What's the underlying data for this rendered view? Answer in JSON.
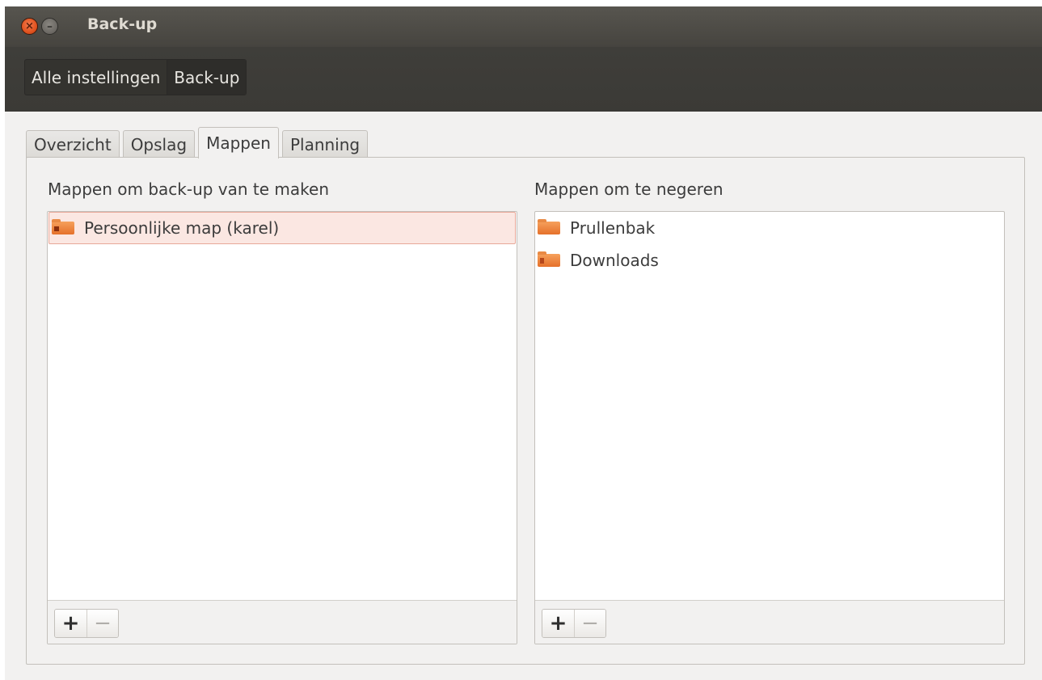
{
  "window": {
    "title": "Back-up",
    "close_glyph": "×",
    "minimize_glyph": "–"
  },
  "breadcrumb": {
    "items": [
      {
        "label": "Alle instellingen"
      },
      {
        "label": "Back-up"
      }
    ]
  },
  "tabs": [
    {
      "label": "Overzicht",
      "active": false
    },
    {
      "label": "Opslag",
      "active": false
    },
    {
      "label": "Mappen",
      "active": true
    },
    {
      "label": "Planning",
      "active": false
    }
  ],
  "include": {
    "label": "Mappen om back-up van te maken",
    "items": [
      {
        "label": "Persoonlijke map (karel)",
        "icon": "home-folder-icon",
        "selected": true
      }
    ],
    "add_glyph": "+",
    "remove_glyph": "−"
  },
  "exclude": {
    "label": "Mappen om te negeren",
    "items": [
      {
        "label": "Prullenbak",
        "icon": "folder-icon",
        "selected": false
      },
      {
        "label": "Downloads",
        "icon": "downloads-folder-icon",
        "selected": false
      }
    ],
    "add_glyph": "+",
    "remove_glyph": "−"
  },
  "colors": {
    "accent_folder": "#e5702a",
    "selection_bg": "#fbe7e2",
    "titlebar": "#4d4b46"
  }
}
